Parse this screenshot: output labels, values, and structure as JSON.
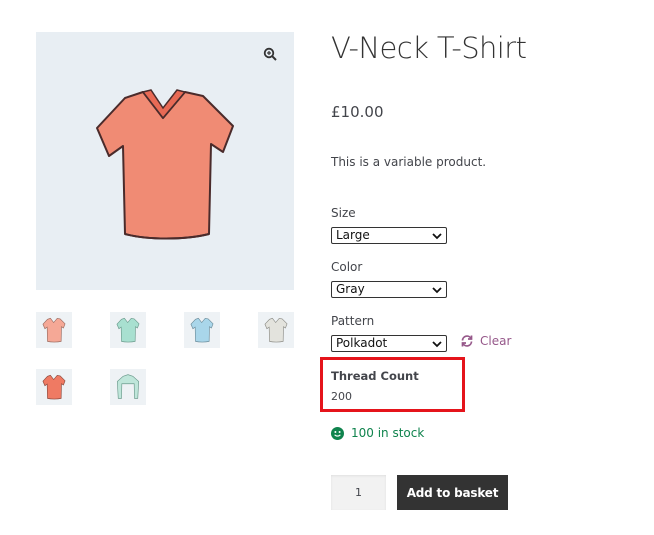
{
  "product": {
    "title": "V-Neck T-Shirt",
    "price": "£10.00",
    "description": "This is a variable product.",
    "main_image_color": "#f08b74"
  },
  "gallery": {
    "zoom_icon": "zoom-in-icon",
    "thumbnails": [
      {
        "color": "#f5a896",
        "bg": "#f2ece9"
      },
      {
        "color": "#a8e0d0",
        "bg": "#edf2f1"
      },
      {
        "color": "#a9d6ea",
        "bg": "#ebf1f4"
      },
      {
        "color": "#e3e3dd",
        "bg": "#f1f1ef"
      },
      {
        "color": "#ef7a63",
        "bg": "#e6ecf1"
      },
      {
        "color": "#bfe6da",
        "bg": "#eef3f2"
      }
    ]
  },
  "variations": {
    "size": {
      "label": "Size",
      "selected": "Large"
    },
    "color": {
      "label": "Color",
      "selected": "Gray"
    },
    "pattern": {
      "label": "Pattern",
      "selected": "Polkadot"
    },
    "clear_label": "Clear"
  },
  "thread_count": {
    "label": "Thread Count",
    "value": "200",
    "highlight_color": "#e5141b"
  },
  "stock": {
    "text": "100 in stock",
    "color": "#0f834d",
    "icon": "smiley-icon"
  },
  "cart": {
    "quantity": "1",
    "add_label": "Add to basket"
  },
  "colors": {
    "accent": "#96588a",
    "button_bg": "#333333"
  }
}
